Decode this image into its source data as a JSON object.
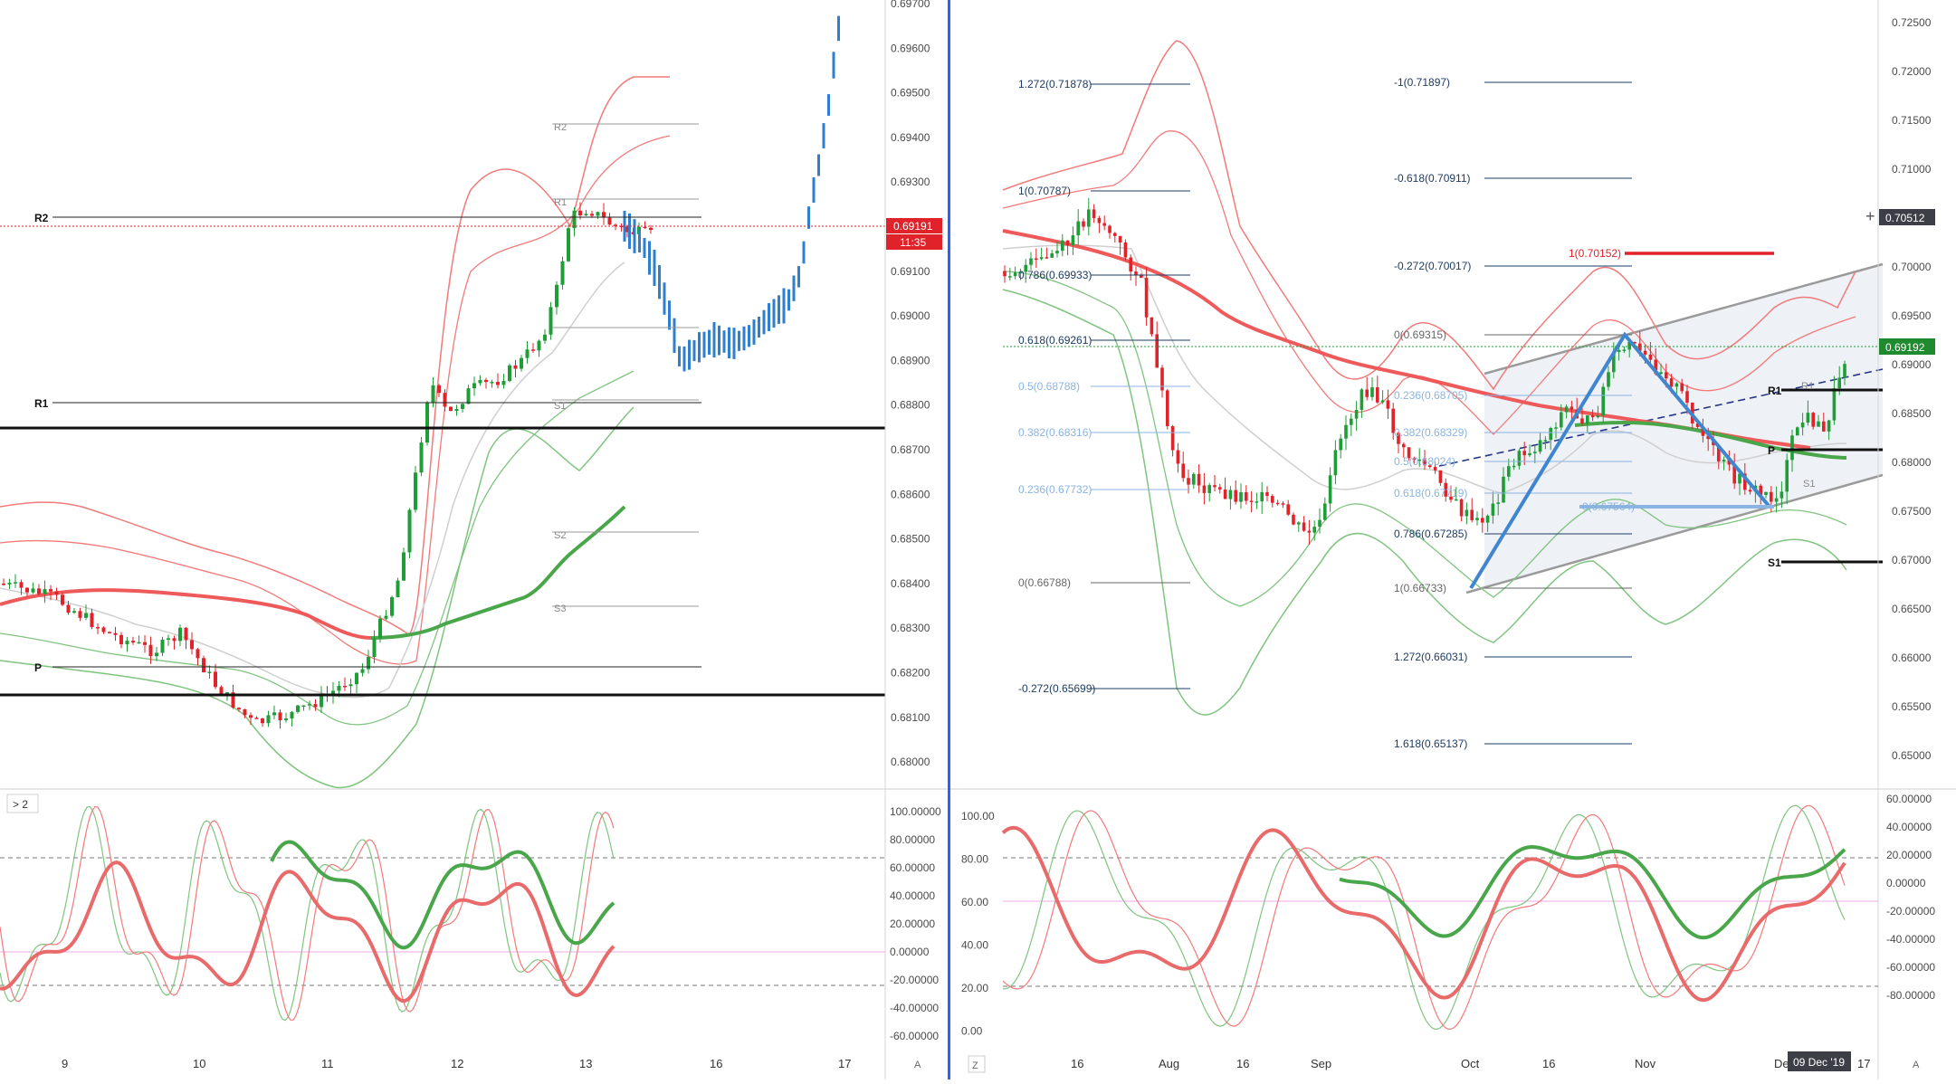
{
  "colors": {
    "up": "#1f9d36",
    "down": "#e0232a",
    "blue": "#2f7fd0",
    "ma_red": "#ee5a5a",
    "ma_green": "#4aa64a",
    "band_red": "#f27a7a",
    "band_green": "#7fc47f",
    "gray": "#cfcfcf",
    "fib_dark": "#1e3c64",
    "fib_light": "#8bb4e0"
  },
  "left_chart": {
    "price_axis": [
      "0.69700",
      "0.69600",
      "0.69500",
      "0.69400",
      "0.69300",
      "0.69200",
      "0.69100",
      "0.69000",
      "0.68900",
      "0.68800",
      "0.68700",
      "0.68600",
      "0.68500",
      "0.68400",
      "0.68300",
      "0.68200",
      "0.68100",
      "0.68000"
    ],
    "current_price": "0.69191",
    "countdown": "11:35",
    "date_labels": [
      "9",
      "10",
      "11",
      "12",
      "13",
      "16",
      "17"
    ],
    "pivot_labels": [
      "R2",
      "R1",
      "P"
    ],
    "level_labels": [
      "R2",
      "R1",
      "S1",
      "S2",
      "S3"
    ],
    "osc_panel_tag": "> 2",
    "osc_axis": [
      "100.00000",
      "80.00000",
      "60.00000",
      "40.00000",
      "20.00000",
      "0.00000",
      "-20.00000",
      "-40.00000",
      "-60.00000"
    ],
    "axis_button": "A"
  },
  "right_chart": {
    "price_axis": [
      "0.72500",
      "0.72000",
      "0.71500",
      "0.71000",
      "0.70500",
      "0.70000",
      "0.69500",
      "0.69000",
      "0.68500",
      "0.68000",
      "0.67500",
      "0.67000",
      "0.66500",
      "0.66000",
      "0.65500",
      "0.65000"
    ],
    "crosshair_price": "0.70512",
    "current_price": "0.69192",
    "date_labels": [
      "16",
      "Aug",
      "16",
      "Sep",
      "Oct",
      "16",
      "Nov",
      "Dec",
      "17"
    ],
    "crosshair_date": "09 Dec '19",
    "fib_left": [
      "1.272(0.71878)",
      "1(0.70787)",
      "0.786(0.69933)",
      "0.618(0.69261)",
      "0.5(0.68788)",
      "0.382(0.68316)",
      "0.236(0.67732)",
      "0(0.66788)",
      "-0.272(0.65699)"
    ],
    "fib_right": [
      "-1(0.71897)",
      "-0.618(0.70911)",
      "-0.272(0.70017)",
      "0(0.69315)",
      "0.236(0.68705)",
      "0.382(0.68329)",
      "0.5(0.68024)",
      "0.618(0.67719)",
      "0.786(0.67285)",
      "1(0.66733)",
      "1.272(0.66031)",
      "1.618(0.65137)"
    ],
    "target_label": "1(0.70152)",
    "proj_label": "0(0.67564)",
    "pivot_labels": [
      "R1",
      "P",
      "S1"
    ],
    "level_labels": [
      "R1",
      "S1"
    ],
    "osc_left_axis": [
      "100.00",
      "80.00",
      "60.00",
      "40.00",
      "20.00",
      "0.00"
    ],
    "osc_right_axis": [
      "60.00000",
      "40.00000",
      "20.00000",
      "0.00000",
      "-20.00000",
      "-40.00000",
      "-60.00000",
      "-80.00000"
    ],
    "z_button": "Z",
    "axis_button": "A"
  },
  "chart_data": [
    {
      "type": "candlestick",
      "title": "",
      "x_labels": [
        "9",
        "10",
        "11",
        "12",
        "13",
        "16",
        "17"
      ],
      "ylim": [
        0.6797,
        0.6971
      ],
      "current_price": 0.69191,
      "horizontal_levels": [
        0.68745,
        0.68145
      ],
      "pivot_levels": {
        "R2": 0.69208,
        "R1": 0.68805,
        "P": 0.68205
      }
    },
    {
      "type": "candlestick",
      "title": "",
      "x_labels": [
        "16",
        "Aug",
        "16",
        "Sep",
        "Oct",
        "16",
        "Nov",
        "Dec",
        "17"
      ],
      "ylim": [
        0.6455,
        0.7265
      ],
      "current_price": 0.69192,
      "fibonacci_retracement": [
        0.71878,
        0.70787,
        0.69933,
        0.69261,
        0.68788,
        0.68316,
        0.67732,
        0.66788,
        0.65699
      ],
      "fibonacci_extension": [
        0.71897,
        0.70911,
        0.70017,
        0.69315,
        0.68705,
        0.68329,
        0.68024,
        0.67719,
        0.67285,
        0.66733,
        0.66031,
        0.65137
      ],
      "target": 0.70152,
      "pivot_levels": {
        "R1": 0.68745,
        "P": 0.68145,
        "S1": 0.67005
      }
    }
  ]
}
